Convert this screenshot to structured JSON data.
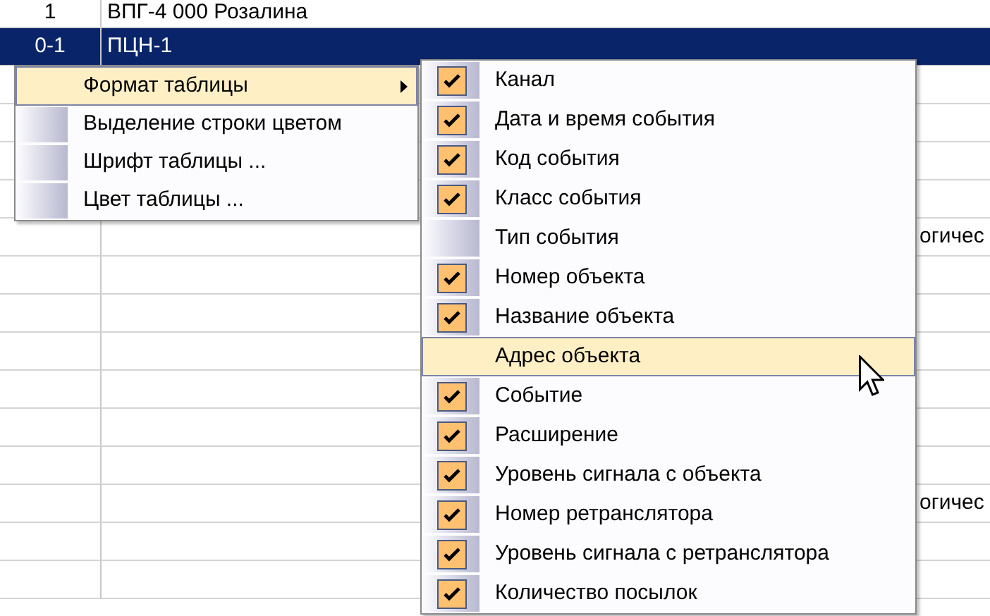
{
  "table": {
    "rows": [
      {
        "selected": false,
        "cells": {
          "column_1": "1",
          "column_2": "ВПГ-4 000 Розалина"
        }
      },
      {
        "selected": true,
        "cells": {
          "column_1": "0-1",
          "column_2": "ПЦН-1"
        }
      },
      {
        "selected": false
      },
      {
        "selected": false
      },
      {
        "selected": false
      },
      {
        "selected": false
      },
      {
        "selected": false,
        "cells": {
          "column_3": "огичес"
        }
      },
      {
        "selected": false
      },
      {
        "selected": false
      },
      {
        "selected": false
      },
      {
        "selected": false
      },
      {
        "selected": false
      },
      {
        "selected": false
      },
      {
        "selected": false,
        "cells": {
          "column_3": "огичес"
        }
      },
      {
        "selected": false
      },
      {
        "selected": false
      }
    ]
  },
  "context_menu": {
    "items": [
      {
        "label": "Формат таблицы",
        "has_submenu": true,
        "selected": true
      },
      {
        "label": "Выделение строки цветом",
        "has_submenu": false,
        "selected": false
      },
      {
        "label": "Шрифт таблицы ...",
        "has_submenu": false,
        "selected": false
      },
      {
        "label": "Цвет таблицы ...",
        "has_submenu": false,
        "selected": false
      }
    ]
  },
  "submenu": {
    "items": [
      {
        "label": "Канал",
        "checked": true,
        "selected": false
      },
      {
        "label": "Дата и время события",
        "checked": true,
        "selected": false
      },
      {
        "label": "Код события",
        "checked": true,
        "selected": false
      },
      {
        "label": "Класс события",
        "checked": true,
        "selected": false
      },
      {
        "label": "Тип события",
        "checked": false,
        "selected": false
      },
      {
        "label": "Номер объекта",
        "checked": true,
        "selected": false
      },
      {
        "label": "Название объекта",
        "checked": true,
        "selected": false
      },
      {
        "label": "Адрес объекта",
        "checked": false,
        "selected": true
      },
      {
        "label": "Событие",
        "checked": true,
        "selected": false
      },
      {
        "label": "Расширение",
        "checked": true,
        "selected": false
      },
      {
        "label": "Уровень сигнала с объекта",
        "checked": true,
        "selected": false
      },
      {
        "label": "Номер ретранслятора",
        "checked": true,
        "selected": false
      },
      {
        "label": "Уровень сигнала с ретранслятора",
        "checked": true,
        "selected": false
      },
      {
        "label": "Количество посылок",
        "checked": true,
        "selected": false
      }
    ]
  }
}
